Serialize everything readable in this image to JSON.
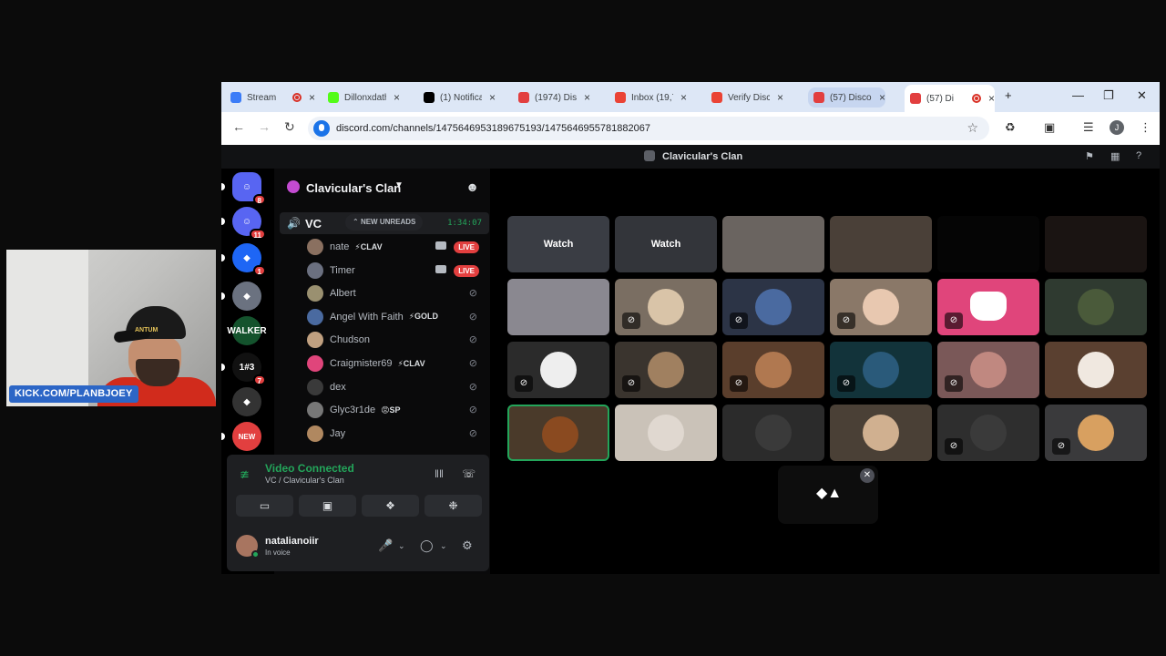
{
  "webcam": {
    "label": "KICK.COM/PLANBJOEY",
    "cap_text": "ANTUM"
  },
  "browser": {
    "tabs": [
      {
        "title": "Stream",
        "favicon_color": "#3b7cf7",
        "recording": true
      },
      {
        "title": "Dillonxdath",
        "favicon_color": "#53fc18",
        "recording": false
      },
      {
        "title": "(1) Notifica",
        "favicon_color": "#000000",
        "recording": false
      },
      {
        "title": "(1974) Disc",
        "favicon_color": "#e23f3f",
        "recording": false
      },
      {
        "title": "Inbox (19,7",
        "favicon_color": "#ea4335",
        "recording": false
      },
      {
        "title": "Verify Disco",
        "favicon_color": "#ea4335",
        "recording": false
      },
      {
        "title": "(57) Discor",
        "favicon_color": "#e23f3f",
        "recording": false
      },
      {
        "title": "(57) Di",
        "favicon_color": "#e23f3f",
        "recording": true
      }
    ],
    "url": "discord.com/channels/1475646953189675193/1475646955781882067",
    "profile_initial": "J",
    "new_tab": "+"
  },
  "discord": {
    "title": "Clavicular's Clan",
    "guilds": [
      {
        "label": "",
        "badge": "8",
        "color": "#5865f2"
      },
      {
        "label": "",
        "badge": "11",
        "color": "#5865f2"
      },
      {
        "label": "",
        "badge": "1",
        "color": "#1e66f5"
      },
      {
        "label": "",
        "badge": "",
        "color": "#6b7280"
      },
      {
        "label": "WALKER",
        "badge": "",
        "color": "#14532d"
      },
      {
        "label": "1#3",
        "badge": "7",
        "color": "#111111"
      },
      {
        "label": "",
        "badge": "",
        "color": "#333333"
      },
      {
        "label": "NEW",
        "badge": "",
        "color": "#e23f3f"
      }
    ],
    "server_name": "Clavicular's Clan",
    "voice_channel": {
      "name": "VC",
      "new_unreads": "NEW UNREADS",
      "elapsed": "1:34:07"
    },
    "members": [
      {
        "name": "nate",
        "tag": "⚡CLAV",
        "live": "LIVE",
        "av": "#8a7060"
      },
      {
        "name": "Timer",
        "tag": "",
        "live": "LIVE",
        "av": "#6b7080"
      },
      {
        "name": "Albert",
        "tag": "",
        "live": "",
        "av": "#9a9070"
      },
      {
        "name": "Angel With Faith",
        "tag": "⚡GOLD",
        "live": "",
        "av": "#4a6aa0"
      },
      {
        "name": "Chudson",
        "tag": "",
        "live": "",
        "av": "#c0a080"
      },
      {
        "name": "Craigmister69",
        "tag": "⚡CLAV",
        "live": "",
        "av": "#e0457b"
      },
      {
        "name": "dex",
        "tag": "",
        "live": "",
        "av": "#3a3a3a"
      },
      {
        "name": "Glyc3r1de",
        "tag": "😡SP",
        "live": "",
        "av": "#777777"
      },
      {
        "name": "Jay",
        "tag": "",
        "live": "",
        "av": "#b08860"
      }
    ],
    "voice_panel": {
      "status": "Video Connected",
      "channel": "VC / Clavicular's Clan"
    },
    "user": {
      "name": "natalianoiir",
      "status": "In voice"
    },
    "tiles": [
      {
        "kind": "watch",
        "label": "Watch",
        "color": "#3a3d44",
        "muted": false
      },
      {
        "kind": "watch",
        "label": "Watch",
        "color": "#33353a",
        "muted": false
      },
      {
        "kind": "video",
        "label": "",
        "color": "#6a6460",
        "muted": false
      },
      {
        "kind": "video",
        "label": "",
        "color": "#4a4038",
        "muted": false
      },
      {
        "kind": "video",
        "label": "",
        "color": "#050505",
        "muted": false
      },
      {
        "kind": "video",
        "label": "",
        "color": "#1a1412",
        "muted": false
      },
      {
        "kind": "video",
        "label": "",
        "color": "#8a8890",
        "muted": false
      },
      {
        "kind": "avatar",
        "label": "",
        "color": "#7a6e62",
        "muted": true,
        "circle": "#d9c4a8"
      },
      {
        "kind": "avatar",
        "label": "",
        "color": "#2c3446",
        "muted": true,
        "circle": "#4a6aa0"
      },
      {
        "kind": "avatar",
        "label": "",
        "color": "#8a7868",
        "muted": true,
        "circle": "#e8c8b0"
      },
      {
        "kind": "discord",
        "label": "",
        "color": "#e0457b",
        "muted": true
      },
      {
        "kind": "avatar",
        "label": "",
        "color": "#2f3a30",
        "muted": false,
        "circle": "#4a5a3a"
      },
      {
        "kind": "avatar",
        "label": "",
        "color": "#2b2b2b",
        "muted": true,
        "circle": "#eeeeee"
      },
      {
        "kind": "avatar",
        "label": "",
        "color": "#3a342e",
        "muted": true,
        "circle": "#a08060"
      },
      {
        "kind": "avatar",
        "label": "",
        "color": "#5a3e2c",
        "muted": true,
        "circle": "#b07850"
      },
      {
        "kind": "avatar",
        "label": "",
        "color": "#12333a",
        "muted": true,
        "circle": "#2a5a7a"
      },
      {
        "kind": "avatar",
        "label": "",
        "color": "#7a5858",
        "muted": true,
        "circle": "#c08880"
      },
      {
        "kind": "avatar",
        "label": "",
        "color": "#5a4030",
        "muted": false,
        "circle": "#f0e8e0"
      },
      {
        "kind": "avatar",
        "label": "",
        "color": "#4a3a2a",
        "muted": false,
        "circle": "#8a4a20",
        "selected": true
      },
      {
        "kind": "avatar",
        "label": "",
        "color": "#cac2b8",
        "muted": false,
        "circle": "#e0d8d0"
      },
      {
        "kind": "avatar",
        "label": "",
        "color": "#2b2b2b",
        "muted": false,
        "circle": "#3a3a3a"
      },
      {
        "kind": "avatar",
        "label": "",
        "color": "#4a4036",
        "muted": false,
        "circle": "#d0b090"
      },
      {
        "kind": "avatar",
        "label": "",
        "color": "#2e2e2e",
        "muted": true,
        "circle": "#3a3a3a"
      },
      {
        "kind": "avatar",
        "label": "",
        "color": "#3a3a3c",
        "muted": true,
        "circle": "#d8a060"
      }
    ]
  }
}
